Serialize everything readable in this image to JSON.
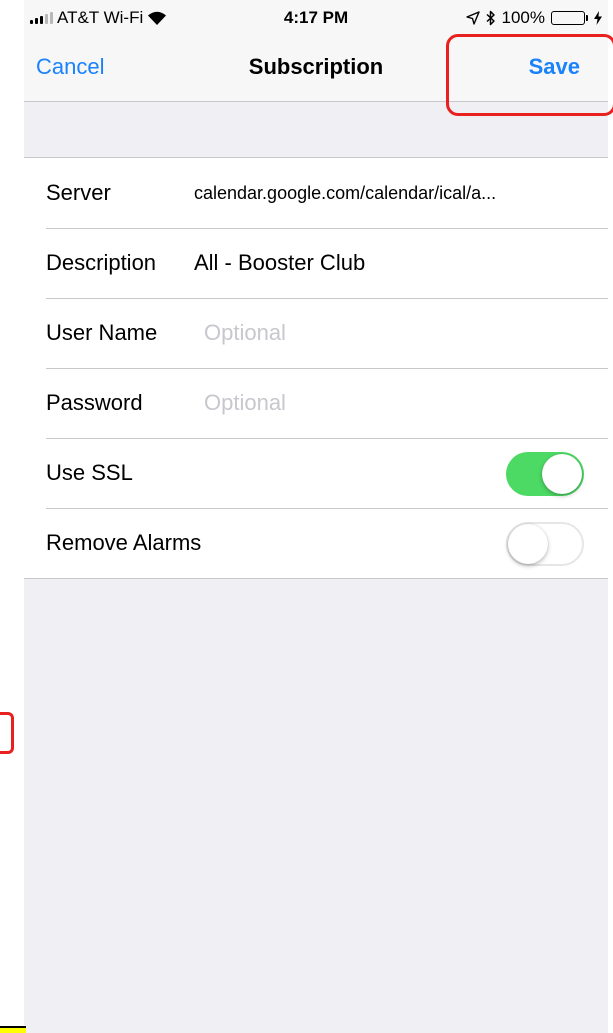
{
  "status_bar": {
    "carrier": "AT&T Wi-Fi",
    "time": "4:17 PM",
    "battery_percent": "100%",
    "icons": [
      "signal-icon",
      "wifi-icon",
      "location-icon",
      "bluetooth-icon",
      "battery-icon",
      "charging-icon"
    ]
  },
  "nav": {
    "cancel_label": "Cancel",
    "title": "Subscription",
    "save_label": "Save"
  },
  "form": {
    "server_label": "Server",
    "server_value": "calendar.google.com/calendar/ical/a...",
    "description_label": "Description",
    "description_value": "All - Booster Club",
    "username_label": "User Name",
    "username_placeholder": "Optional",
    "password_label": "Password",
    "password_placeholder": "Optional",
    "ssl_label": "Use SSL",
    "ssl_on": true,
    "remove_alarms_label": "Remove Alarms",
    "remove_alarms_on": false
  },
  "colors": {
    "accent": "#1a82fb",
    "toggle_on": "#4cd964",
    "highlight": "#e8211f",
    "background": "#efeff4"
  }
}
